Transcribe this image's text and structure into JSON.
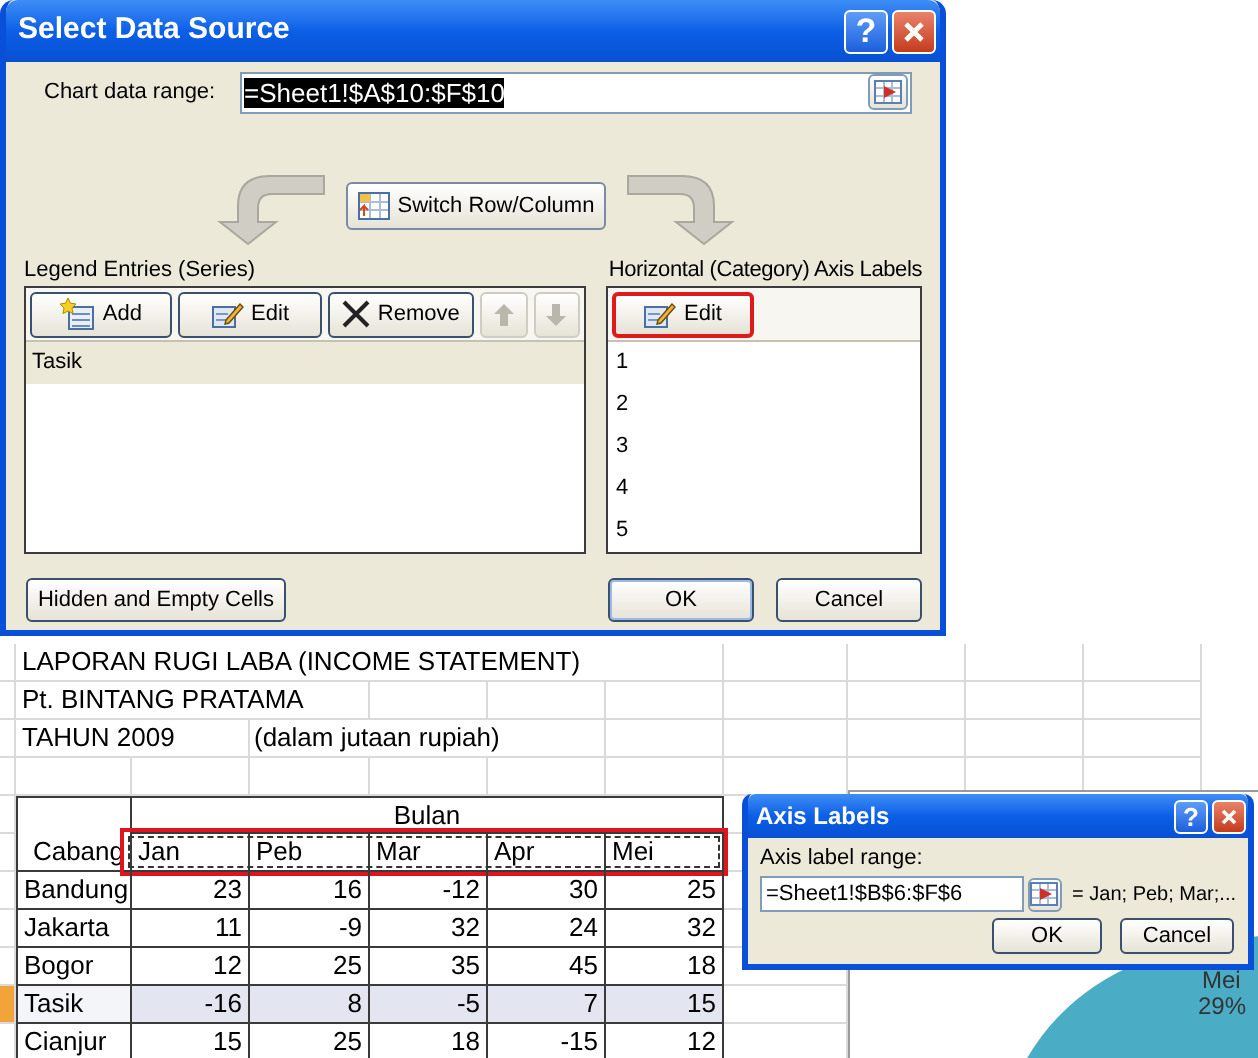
{
  "dialog": {
    "title": "Select Data Source",
    "help": "?",
    "range_label": "Chart data range:",
    "range_value": "=Sheet1!$A$10:$F$10",
    "switch_button": "Switch Row/Column",
    "legend": {
      "heading": "Legend Entries (Series)",
      "buttons": [
        {
          "kind": "add",
          "label": "Add",
          "disabled": false
        },
        {
          "kind": "edit",
          "label": "Edit",
          "disabled": false
        },
        {
          "kind": "remove",
          "label": "Remove",
          "disabled": false
        },
        {
          "kind": "up",
          "disabled": true
        },
        {
          "kind": "down",
          "disabled": true
        }
      ],
      "items": [
        {
          "label": "Tasik",
          "selected": true
        }
      ]
    },
    "axis": {
      "heading": "Horizontal (Category) Axis Labels",
      "edit_button": "Edit",
      "edit_highlighted": true,
      "items": [
        "1",
        "2",
        "3",
        "4",
        "5"
      ]
    },
    "hidden_button": "Hidden and Empty Cells",
    "ok": "OK",
    "cancel": "Cancel"
  },
  "sheet": {
    "title": "LAPORAN RUGI LABA (INCOME STATEMENT)",
    "company": "Pt. BINTANG PRATAMA",
    "year": "TAHUN 2009",
    "unit": "(dalam jutaan rupiah)",
    "group_header": "Bulan",
    "row_header": "Cabang",
    "months": [
      "Jan",
      "Peb",
      "Mar",
      "Apr",
      "Mei"
    ],
    "months_highlighted": true,
    "rows": [
      {
        "name": "Bandung",
        "values": [
          "23",
          "16",
          "-12",
          "30",
          "25"
        ],
        "selected": false
      },
      {
        "name": "Jakarta",
        "values": [
          "11",
          "-9",
          "32",
          "24",
          "32"
        ],
        "selected": false
      },
      {
        "name": "Bogor",
        "values": [
          "12",
          "25",
          "35",
          "45",
          "18"
        ],
        "selected": false
      },
      {
        "name": "Tasik",
        "values": [
          "-16",
          "8",
          "-5",
          "7",
          "15"
        ],
        "selected": true
      },
      {
        "name": "Cianjur",
        "values": [
          "15",
          "25",
          "18",
          "-15",
          "12"
        ],
        "selected": false
      }
    ]
  },
  "chart": {
    "slice_label": "Mei",
    "slice_value": "29%"
  },
  "axis_dialog": {
    "title": "Axis Labels",
    "help": "?",
    "field_label": "Axis label range:",
    "value": "=Sheet1!$B$6:$F$6",
    "preview": "= Jan; Peb; Mar;...",
    "ok": "OK",
    "cancel": "Cancel"
  }
}
